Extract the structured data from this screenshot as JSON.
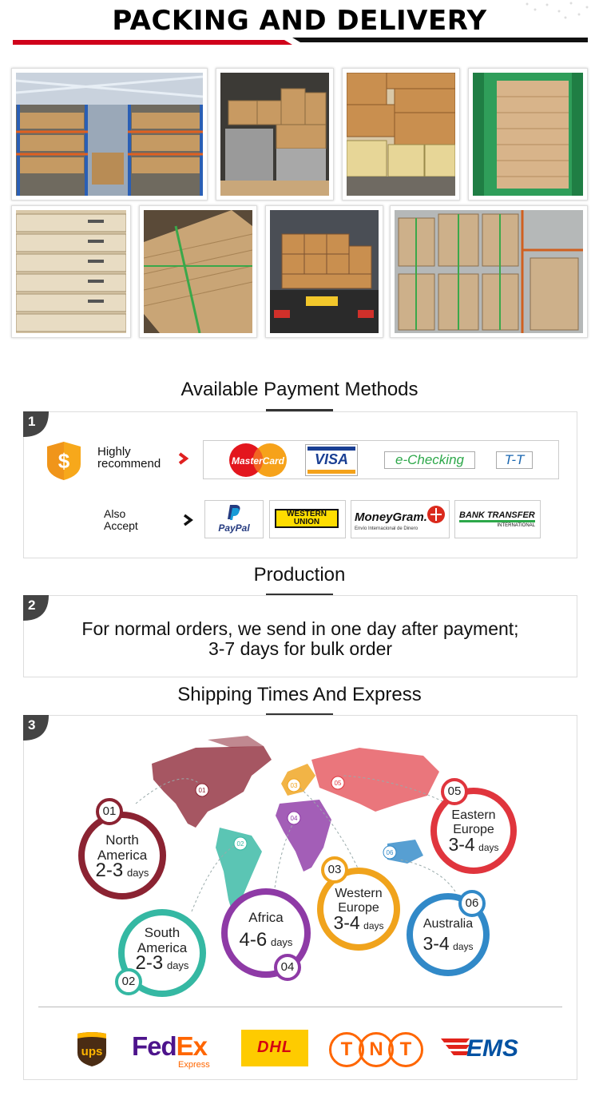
{
  "header": {
    "title": "PACKING AND DELIVERY",
    "accent_color": "#d0021b"
  },
  "payment": {
    "title": "Available Payment Methods",
    "step": "1",
    "highly_line1": "Highly",
    "highly_line2": "recommend",
    "also_line1": "Also",
    "also_line2": "Accept",
    "methods_recommend": [
      "MasterCard",
      "VISA",
      "e-Checking",
      "T-T"
    ],
    "methods_also": {
      "paypal": "PayPal",
      "western1": "WESTERN",
      "western2": "UNION",
      "moneygram": "MoneyGram.",
      "moneygram_sub": "Envío Internacional de Dinero",
      "bank1": "BANK TRANSFER",
      "bank2": "INTERNATIONAL"
    }
  },
  "production": {
    "title": "Production",
    "step": "2",
    "line1": "For normal orders, we send in one day after payment;",
    "line2": "3-7 days for bulk order"
  },
  "shipping": {
    "title": "Shipping Times And Express",
    "step": "3",
    "regions": [
      {
        "num": "01",
        "name1": "North",
        "name2": "America",
        "days": "2-3",
        "unit": "days",
        "color": "#8b2332"
      },
      {
        "num": "02",
        "name1": "South",
        "name2": "America",
        "days": "2-3",
        "unit": "days",
        "color": "#35b8a3"
      },
      {
        "num": "04",
        "name1": "Africa",
        "name2": "",
        "days": "4-6",
        "unit": "days",
        "color": "#8e3aa6"
      },
      {
        "num": "03",
        "name1": "Western",
        "name2": "Europe",
        "days": "3-4",
        "unit": "days",
        "color": "#f0a31c"
      },
      {
        "num": "06",
        "name1": "Australia",
        "name2": "",
        "days": "3-4",
        "unit": "days",
        "color": "#3189c8"
      },
      {
        "num": "05",
        "name1": "Eastern",
        "name2": "Europe",
        "days": "3-4",
        "unit": "days",
        "color": "#e0353d"
      }
    ],
    "map_labels": [
      "01",
      "02",
      "03",
      "04",
      "05",
      "06"
    ],
    "couriers": {
      "ups": "ups",
      "fedex1": "Fed",
      "fedex2": "Ex",
      "fedex_sub": "Express",
      "dhl": "DHL",
      "tnt": [
        "T",
        "N",
        "T"
      ],
      "ems": "EMS"
    }
  }
}
